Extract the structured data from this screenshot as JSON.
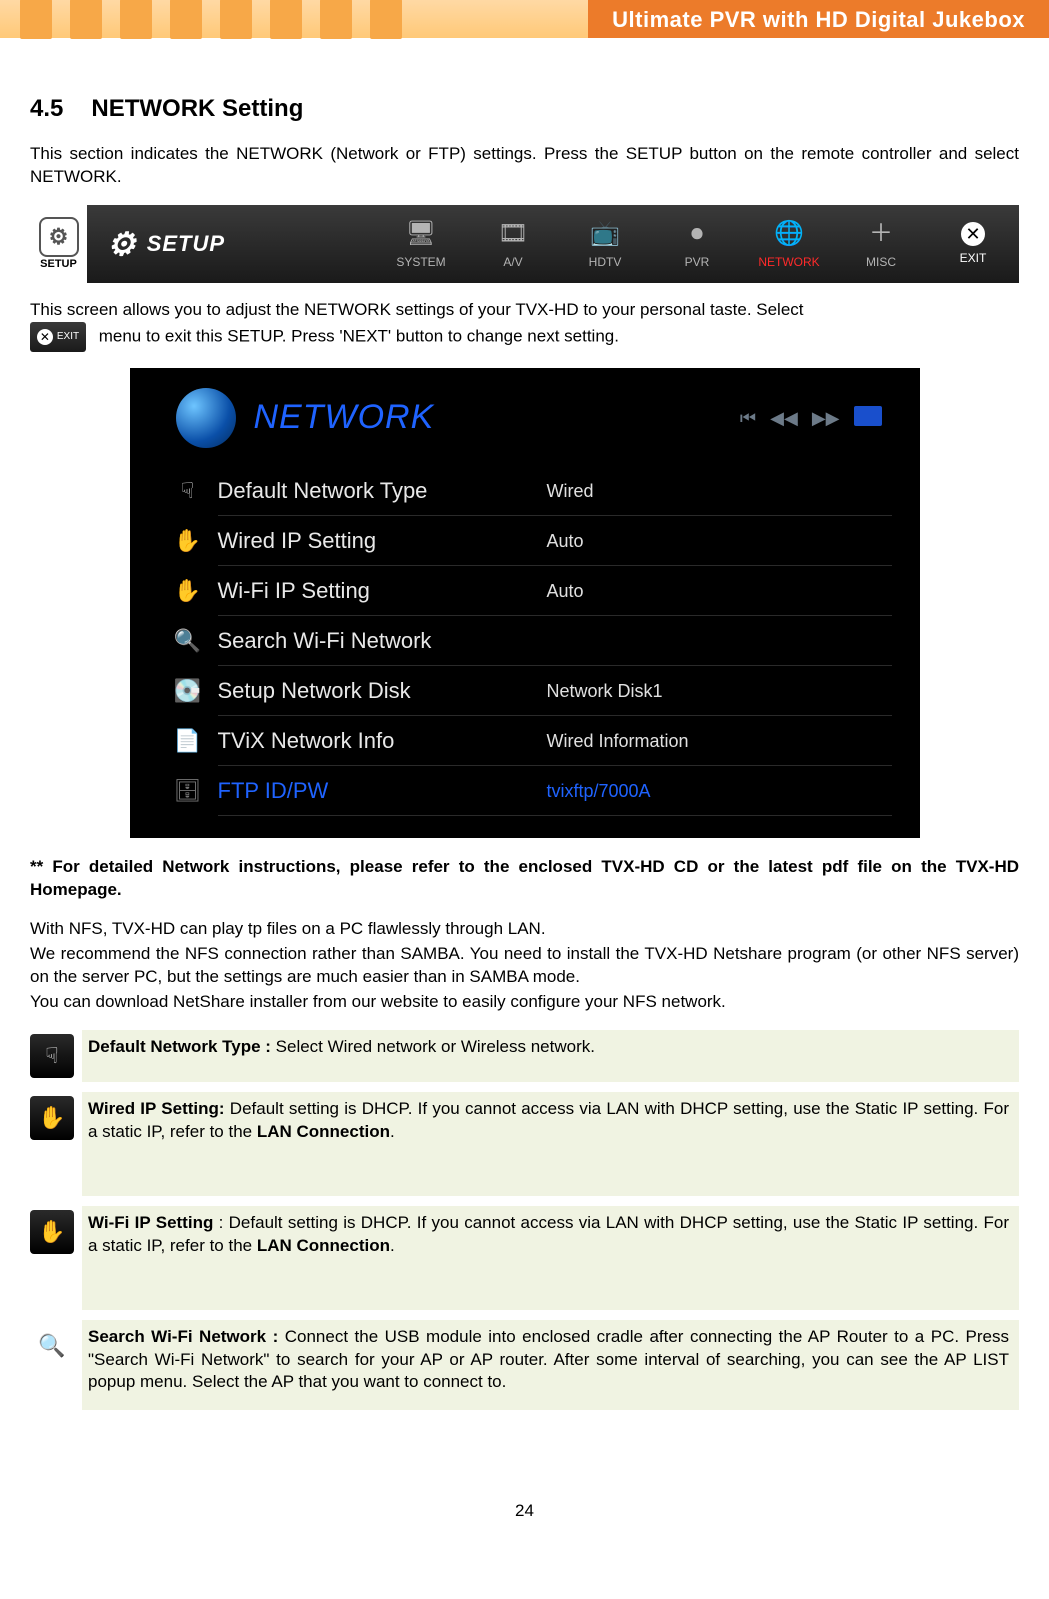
{
  "banner": "Ultimate PVR with HD Digital Jukebox",
  "section_number": "4.5",
  "section_title": "NETWORK Setting",
  "intro": "This section indicates the NETWORK (Network or FTP) settings. Press the SETUP button on the remote controller and select NETWORK.",
  "setup_button_label": "SETUP",
  "setup_bar_label": "SETUP",
  "menu": {
    "system": "SYSTEM",
    "av": "A/V",
    "hdtv": "HDTV",
    "pvr": "PVR",
    "network": "NETWORK",
    "misc": "MISC",
    "exit": "EXIT"
  },
  "para2_a": "This screen allows you to adjust the NETWORK settings of your TVX-HD to your personal taste. Select",
  "para2_b": "menu to exit this SETUP. Press 'NEXT' button to change next setting.",
  "exit_chip": "EXIT",
  "panel_title": "NETWORK",
  "net_rows": [
    {
      "label": "Default Network Type",
      "value": "Wired"
    },
    {
      "label": "Wired IP Setting",
      "value": "Auto"
    },
    {
      "label": "Wi-Fi IP Setting",
      "value": "Auto"
    },
    {
      "label": "Search Wi-Fi Network",
      "value": ""
    },
    {
      "label": "Setup Network Disk",
      "value": "Network Disk1"
    },
    {
      "label": "TViX Network Info",
      "value": "Wired Information"
    },
    {
      "label": "FTP ID/PW",
      "value": "tvixftp/7000A"
    }
  ],
  "note_bold": "** For detailed Network instructions, please refer to the enclosed TVX-HD CD or the latest pdf file on the TVX-HD Homepage.",
  "nfs1": "With NFS, TVX-HD can play tp files on a PC flawlessly through LAN.",
  "nfs2": "We recommend the NFS connection rather than SAMBA. You need to install the TVX-HD Netshare program (or other NFS server) on the server PC, but the settings are much easier than in SAMBA mode.",
  "nfs3": "You can download NetShare installer from our website to easily configure your NFS network.",
  "settings": {
    "r1_head": "Default Network Type : ",
    "r1_body": "Select Wired network or Wireless network.",
    "r2_head": "Wired IP Setting: ",
    "r2_body_a": "Default setting is DHCP. If you cannot access via LAN with DHCP setting, use the Static IP setting. For a static IP, refer to the ",
    "r2_body_b": "LAN Connection",
    "r2_body_c": ".",
    "r3_head": "Wi-Fi IP Setting ",
    "r3_body_a": ": Default setting is DHCP. If you cannot access via LAN with DHCP setting, use the Static IP setting. For a static IP, refer to the ",
    "r3_body_b": "LAN Connection",
    "r3_body_c": ".",
    "r4_head": "Search Wi-Fi Network : ",
    "r4_body": "Connect the USB module into enclosed cradle after connecting the AP Router to a PC. Press \"Search Wi-Fi Network\" to search for your AP or AP router. After some interval of searching, you can see the AP LIST popup menu. Select the AP that you want to connect to."
  },
  "page_number": "24"
}
